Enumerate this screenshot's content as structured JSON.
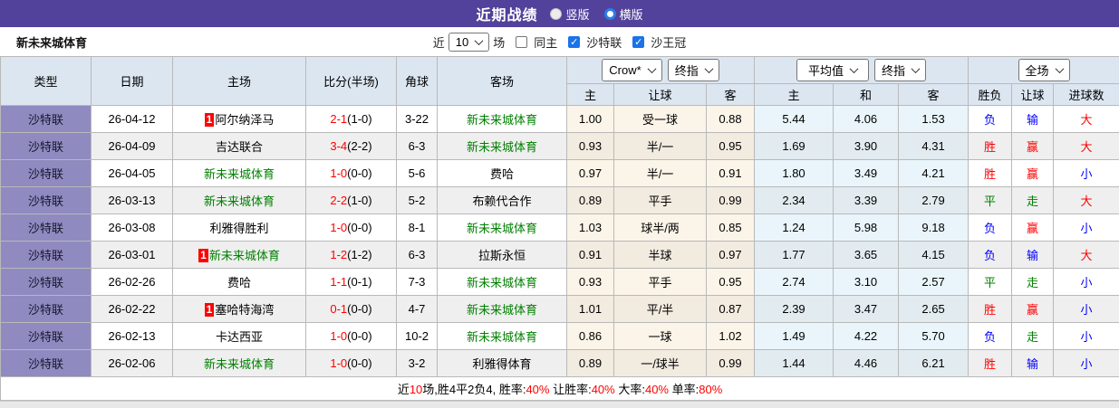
{
  "topbar": {
    "title": "近期战绩",
    "radio_vertical": "竖版",
    "radio_horizontal": "横版"
  },
  "filter": {
    "team": "新未来城体育",
    "near_label": "近",
    "games_value": "10",
    "games_suffix": "场",
    "checkbox_same_home": "同主",
    "checkbox_league1": "沙特联",
    "checkbox_league2": "沙王冠",
    "checkbox_states": {
      "same_home": false,
      "league1": true,
      "league2": true
    }
  },
  "table": {
    "headers_left": [
      "类型",
      "日期",
      "主场",
      "比分(半场)",
      "角球",
      "客场"
    ],
    "selects": {
      "odds_source": "Crow*",
      "odds_time": "终指",
      "avg_source": "平均值",
      "avg_time": "终指",
      "scope": "全场"
    },
    "headers_sub": [
      "主",
      "让球",
      "客",
      "主",
      "和",
      "客",
      "胜负",
      "让球",
      "进球数"
    ],
    "rows": [
      {
        "type": "沙特联",
        "date": "26-04-12",
        "home": "阿尔纳泽马",
        "home_green": false,
        "home_badge": "1",
        "score": "2-1",
        "half": "(1-0)",
        "corner": "3-22",
        "away": "新未来城体育",
        "away_green": true,
        "o1": "1.00",
        "handicap": "受一球",
        "o2": "0.88",
        "a1": "5.44",
        "a2": "4.06",
        "a3": "1.53",
        "res": [
          "负",
          "输",
          "大"
        ],
        "res_colors": [
          "b",
          "b",
          "r"
        ]
      },
      {
        "type": "沙特联",
        "date": "26-04-09",
        "home": "吉达联合",
        "home_green": false,
        "home_badge": "",
        "score": "3-4",
        "half": "(2-2)",
        "corner": "6-3",
        "away": "新未来城体育",
        "away_green": true,
        "o1": "0.93",
        "handicap": "半/一",
        "o2": "0.95",
        "a1": "1.69",
        "a2": "3.90",
        "a3": "4.31",
        "res": [
          "胜",
          "赢",
          "大"
        ],
        "res_colors": [
          "r",
          "r",
          "r"
        ]
      },
      {
        "type": "沙特联",
        "date": "26-04-05",
        "home": "新未来城体育",
        "home_green": true,
        "home_badge": "",
        "score": "1-0",
        "half": "(0-0)",
        "corner": "5-6",
        "away": "费哈",
        "away_green": false,
        "o1": "0.97",
        "handicap": "半/一",
        "o2": "0.91",
        "a1": "1.80",
        "a2": "3.49",
        "a3": "4.21",
        "res": [
          "胜",
          "赢",
          "小"
        ],
        "res_colors": [
          "r",
          "r",
          "b"
        ]
      },
      {
        "type": "沙特联",
        "date": "26-03-13",
        "home": "新未来城体育",
        "home_green": true,
        "home_badge": "",
        "score": "2-2",
        "half": "(1-0)",
        "corner": "5-2",
        "away": "布赖代合作",
        "away_green": false,
        "o1": "0.89",
        "handicap": "平手",
        "o2": "0.99",
        "a1": "2.34",
        "a2": "3.39",
        "a3": "2.79",
        "res": [
          "平",
          "走",
          "大"
        ],
        "res_colors": [
          "g",
          "g",
          "r"
        ]
      },
      {
        "type": "沙特联",
        "date": "26-03-08",
        "home": "利雅得胜利",
        "home_green": false,
        "home_badge": "",
        "score": "1-0",
        "half": "(0-0)",
        "corner": "8-1",
        "away": "新未来城体育",
        "away_green": true,
        "o1": "1.03",
        "handicap": "球半/两",
        "o2": "0.85",
        "a1": "1.24",
        "a2": "5.98",
        "a3": "9.18",
        "res": [
          "负",
          "赢",
          "小"
        ],
        "res_colors": [
          "b",
          "r",
          "b"
        ]
      },
      {
        "type": "沙特联",
        "date": "26-03-01",
        "home": "新未来城体育",
        "home_green": true,
        "home_badge": "1",
        "score": "1-2",
        "half": "(1-2)",
        "corner": "6-3",
        "away": "拉斯永恒",
        "away_green": false,
        "o1": "0.91",
        "handicap": "半球",
        "o2": "0.97",
        "a1": "1.77",
        "a2": "3.65",
        "a3": "4.15",
        "res": [
          "负",
          "输",
          "大"
        ],
        "res_colors": [
          "b",
          "b",
          "r"
        ]
      },
      {
        "type": "沙特联",
        "date": "26-02-26",
        "home": "费哈",
        "home_green": false,
        "home_badge": "",
        "score": "1-1",
        "half": "(0-1)",
        "corner": "7-3",
        "away": "新未来城体育",
        "away_green": true,
        "o1": "0.93",
        "handicap": "平手",
        "o2": "0.95",
        "a1": "2.74",
        "a2": "3.10",
        "a3": "2.57",
        "res": [
          "平",
          "走",
          "小"
        ],
        "res_colors": [
          "g",
          "g",
          "b"
        ]
      },
      {
        "type": "沙特联",
        "date": "26-02-22",
        "home": "塞哈特海湾",
        "home_green": false,
        "home_badge": "1",
        "score": "0-1",
        "half": "(0-0)",
        "corner": "4-7",
        "away": "新未来城体育",
        "away_green": true,
        "o1": "1.01",
        "handicap": "平/半",
        "o2": "0.87",
        "a1": "2.39",
        "a2": "3.47",
        "a3": "2.65",
        "res": [
          "胜",
          "赢",
          "小"
        ],
        "res_colors": [
          "r",
          "r",
          "b"
        ]
      },
      {
        "type": "沙特联",
        "date": "26-02-13",
        "home": "卡达西亚",
        "home_green": false,
        "home_badge": "",
        "score": "1-0",
        "half": "(0-0)",
        "corner": "10-2",
        "away": "新未来城体育",
        "away_green": true,
        "o1": "0.86",
        "handicap": "一球",
        "o2": "1.02",
        "a1": "1.49",
        "a2": "4.22",
        "a3": "5.70",
        "res": [
          "负",
          "走",
          "小"
        ],
        "res_colors": [
          "b",
          "g",
          "b"
        ]
      },
      {
        "type": "沙特联",
        "date": "26-02-06",
        "home": "新未来城体育",
        "home_green": true,
        "home_badge": "",
        "score": "1-0",
        "half": "(0-0)",
        "corner": "3-2",
        "away": "利雅得体育",
        "away_green": false,
        "o1": "0.89",
        "handicap": "一/球半",
        "o2": "0.99",
        "a1": "1.44",
        "a2": "4.46",
        "a3": "6.21",
        "res": [
          "胜",
          "输",
          "小"
        ],
        "res_colors": [
          "r",
          "b",
          "b"
        ]
      }
    ]
  },
  "footer": {
    "segments": [
      {
        "text": "近",
        "red": false
      },
      {
        "text": "10",
        "red": true
      },
      {
        "text": "场,胜4平2负4, 胜率:",
        "red": false
      },
      {
        "text": "40%",
        "red": true
      },
      {
        "text": " 让胜率:",
        "red": false
      },
      {
        "text": "40%",
        "red": true
      },
      {
        "text": " 大率:",
        "red": false
      },
      {
        "text": "40%",
        "red": true
      },
      {
        "text": " 单率:",
        "red": false
      },
      {
        "text": "80%",
        "red": true
      }
    ]
  },
  "colors": {
    "accent_purple": "#52429b",
    "type_cell_purple": "#8f8ac0",
    "header_bg": "#dce6f1",
    "win_red": "#ff0000",
    "lose_blue": "#0000ff",
    "draw_green": "#008000",
    "team_green": "#008000"
  }
}
